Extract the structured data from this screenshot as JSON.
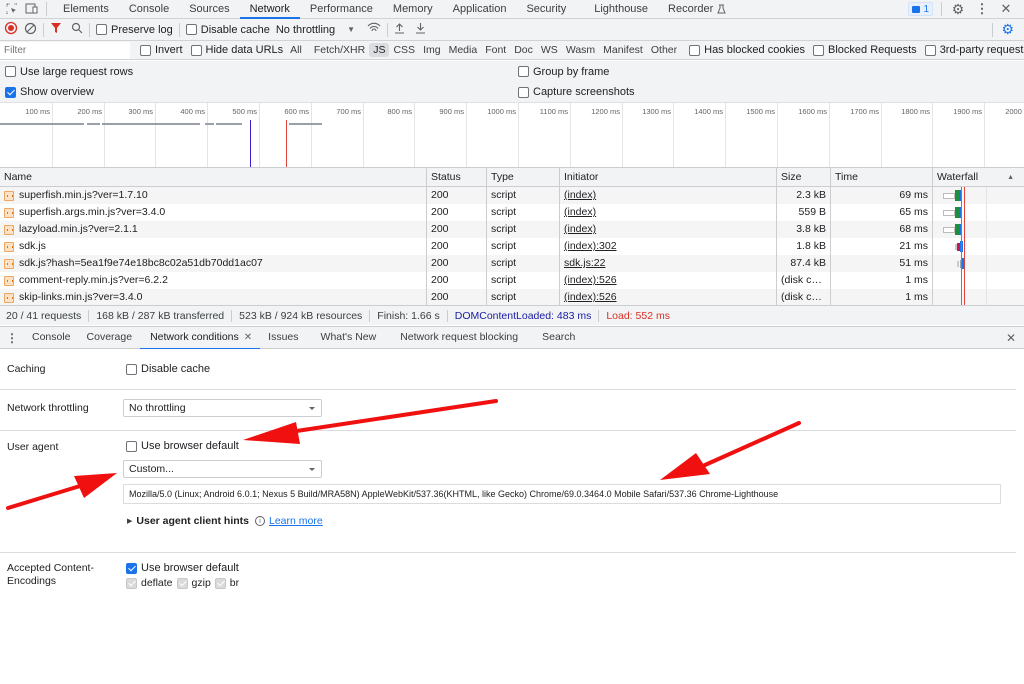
{
  "tabs": {
    "inspect_icon": "inspect-element-icon",
    "device_icon": "device-toolbar-icon",
    "items": [
      "Elements",
      "Console",
      "Sources",
      "Network",
      "Performance",
      "Memory",
      "Application",
      "Security",
      "Lighthouse",
      "Recorder"
    ],
    "active": "Network",
    "issues_count": "1"
  },
  "toolbar": {
    "preserve_log": "Preserve log",
    "preserve_log_checked": false,
    "disable_cache": "Disable cache",
    "disable_cache_checked": false,
    "throttling": "No throttling"
  },
  "filterbar": {
    "placeholder": "Filter",
    "invert": "Invert",
    "hide_data_urls": "Hide data URLs",
    "types": [
      "All",
      "Fetch/XHR",
      "JS",
      "CSS",
      "Img",
      "Media",
      "Font",
      "Doc",
      "WS",
      "Wasm",
      "Manifest",
      "Other"
    ],
    "active_type": "JS",
    "has_blocked_cookies": "Has blocked cookies",
    "blocked_requests": "Blocked Requests",
    "third_party": "3rd-party requests"
  },
  "options": {
    "large_rows": "Use large request rows",
    "large_rows_checked": false,
    "group_by_frame": "Group by frame",
    "group_by_frame_checked": false,
    "show_overview": "Show overview",
    "show_overview_checked": true,
    "capture_screenshots": "Capture screenshots",
    "capture_screenshots_checked": false
  },
  "overview": {
    "ticks": [
      "100 ms",
      "200 ms",
      "300 ms",
      "400 ms",
      "500 ms",
      "600 ms",
      "700 ms",
      "800 ms",
      "900 ms",
      "1000 ms",
      "1100 ms",
      "1200 ms",
      "1300 ms",
      "1400 ms",
      "1500 ms",
      "1600 ms",
      "1700 ms",
      "1800 ms",
      "1900 ms",
      "2000 ms"
    ],
    "dom_content_loaded_ms": 483,
    "load_ms": 552,
    "dcl_color": "#3f1bd6",
    "load_color": "#e0453d"
  },
  "table": {
    "headers": {
      "name": "Name",
      "status": "Status",
      "type": "Type",
      "initiator": "Initiator",
      "size": "Size",
      "time": "Time",
      "waterfall": "Waterfall"
    },
    "rows": [
      {
        "name": "superfish.min.js?ver=1.7.10",
        "status": "200",
        "type": "script",
        "initiator": "(index)",
        "size": "2.3 kB",
        "time": "69 ms"
      },
      {
        "name": "superfish.args.min.js?ver=3.4.0",
        "status": "200",
        "type": "script",
        "initiator": "(index)",
        "size": "559 B",
        "time": "65 ms"
      },
      {
        "name": "lazyload.min.js?ver=2.1.1",
        "status": "200",
        "type": "script",
        "initiator": "(index)",
        "size": "3.8 kB",
        "time": "68 ms"
      },
      {
        "name": "sdk.js",
        "status": "200",
        "type": "script",
        "initiator": "(index):302",
        "size": "1.8 kB",
        "time": "21 ms"
      },
      {
        "name": "sdk.js?hash=5ea1f9e74e18bc8c02a51db70dd1ac07",
        "status": "200",
        "type": "script",
        "initiator": "sdk.js:22",
        "size": "87.4 kB",
        "time": "51 ms"
      },
      {
        "name": "comment-reply.min.js?ver=6.2.2",
        "status": "200",
        "type": "script",
        "initiator": "(index):526",
        "size": "(disk cac...",
        "time": "1 ms"
      },
      {
        "name": "skip-links.min.js?ver=3.4.0",
        "status": "200",
        "type": "script",
        "initiator": "(index):526",
        "size": "(disk cac...",
        "time": "1 ms"
      }
    ]
  },
  "status": {
    "requests": "20 / 41 requests",
    "transferred": "168 kB / 287 kB transferred",
    "resources": "523 kB / 924 kB resources",
    "finish": "Finish: 1.66 s",
    "dcl": "DOMContentLoaded: 483 ms",
    "load": "Load: 552 ms",
    "dcl_color": "#1a1aa6",
    "load_color": "#d93025"
  },
  "drawer": {
    "tabs": [
      "Console",
      "Coverage",
      "Network conditions",
      "Issues",
      "What's New",
      "Network request blocking",
      "Search"
    ],
    "active": "Network conditions"
  },
  "conditions": {
    "caching_label": "Caching",
    "disable_cache": "Disable cache",
    "disable_cache_checked": false,
    "throttling_label": "Network throttling",
    "throttling_value": "No throttling",
    "ua_label": "User agent",
    "ua_default": "Use browser default",
    "ua_default_checked": false,
    "ua_select": "Custom...",
    "ua_string": "Mozilla/5.0 (Linux; Android 6.0.1; Nexus 5 Build/MRA58N) AppleWebKit/537.36(KHTML, like Gecko) Chrome/69.0.3464.0 Mobile Safari/537.36 Chrome-Lighthouse",
    "client_hints": "User agent client hints",
    "learn_more": "Learn more",
    "encodings_label_1": "Accepted Content-",
    "encodings_label_2": "Encodings",
    "encodings_default": "Use browser default",
    "encodings_default_checked": true,
    "encodings": [
      "deflate",
      "gzip",
      "br"
    ]
  },
  "annotation": {
    "arrow_color": "#f01010",
    "arrow_count": 3
  }
}
